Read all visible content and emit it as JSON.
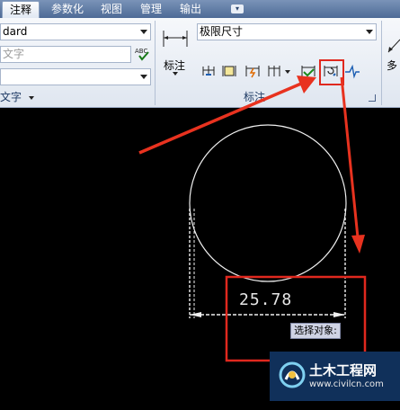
{
  "tabs": [
    {
      "label": "注释",
      "active": true
    },
    {
      "label": "参数化",
      "active": false
    },
    {
      "label": "视图",
      "active": false
    },
    {
      "label": "管理",
      "active": false
    },
    {
      "label": "输出",
      "active": false
    }
  ],
  "tab_overflow_icon": "dropdown-icon",
  "text_panel": {
    "style_combo_value": "dard",
    "text_input_placeholder": "文字",
    "third_combo_value": "",
    "title": "文字"
  },
  "dimension_panel": {
    "big_button_label": "标注",
    "style_combo_value": "极限尺寸",
    "title": "标注",
    "buttons": [
      "dim-continue-icon",
      "dim-baseline-icon",
      "dim-break-icon",
      "dim-space-icon",
      "dim-inspect-icon",
      "dim-update-icon",
      "dim-jog-icon"
    ]
  },
  "right_panel": {
    "button_label": "多"
  },
  "drawing": {
    "dimension_value": "25.78",
    "command_prompt": "选择对象:"
  },
  "colors": {
    "highlight_red": "#e0281e",
    "arrow_red": "#e8321f",
    "ribbon_bg": "#e9eef5",
    "tab_bar": "#5f7aa3"
  },
  "watermark": {
    "title": "土木工程网",
    "url": "www.civilcn.com"
  }
}
